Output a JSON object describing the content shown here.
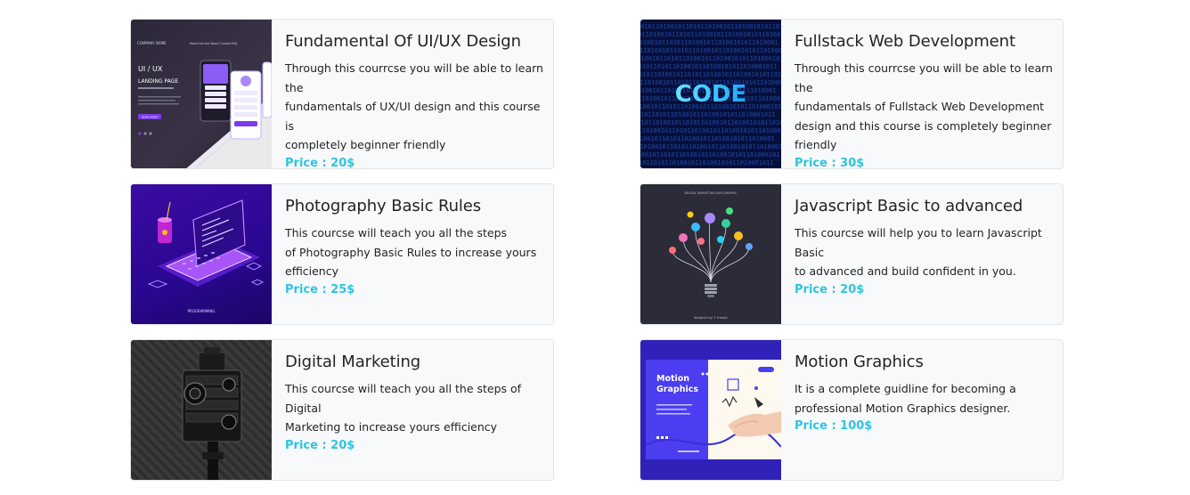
{
  "courses": [
    {
      "title": "Fundamental Of UI/UX Design",
      "desc": [
        "Through this courrcse you will be able to learn the",
        "fundamentals of UX/UI design and this course is",
        "completely beginner friendly"
      ],
      "price": "Price : 20$",
      "thumb": {
        "brand": "COMPANY NAME",
        "nav": "Home  Service  About  Contact  FAQ",
        "heading1": "UI / UX",
        "heading2": "LANDING PAGE",
        "button": "READ MORE",
        "icon": "phone-mockup-illustration"
      }
    },
    {
      "title": "Fullstack Web Development",
      "desc": [
        "Through this courrcse you will be able to learn the",
        "fundamentals of Fullstack Web Development",
        "design and this course is completely beginner",
        "friendly"
      ],
      "price": "Price : 30$",
      "thumb": {
        "word": "CODE",
        "binary": "0101101001011010110100101101001010110100",
        "icon": "binary-code-illustration"
      }
    },
    {
      "title": "Photography Basic Rules",
      "desc": [
        "This courcse will teach you all the steps",
        "of Photography Basic Rules to increase yours",
        "efficiency"
      ],
      "price": "Price : 25$",
      "thumb": {
        "caption": "PROGRAMMING",
        "icon": "isometric-laptop-illustration"
      }
    },
    {
      "title": "Javascript Basic to advanced",
      "desc": [
        "This courcse will help you to learn Javascript Basic",
        "to advanced and build confident in you."
      ],
      "price": "Price : 20$",
      "thumb": {
        "header": "DIGITAL MARKETING INFOGRAPHIC",
        "footer": "designed by ⚘ freepik",
        "icon": "lightbulb-infographic-illustration"
      }
    },
    {
      "title": "Digital Marketing",
      "desc": [
        "This courcse will teach you all the steps of Digital",
        "Marketing to increase yours efficiency"
      ],
      "price": "Price : 20$",
      "thumb": {
        "icon": "vintage-camera-photo"
      }
    },
    {
      "title": "Motion Graphics",
      "desc": [
        "It is a complete guidline for becoming a",
        "professional Motion Graphics designer."
      ],
      "price": "Price : 100$",
      "thumb": {
        "line1": "Motion",
        "line2": "Graphics",
        "icon": "motion-graphics-hand-illustration"
      }
    }
  ],
  "colors": {
    "price": "#2ec4e0",
    "card_bg": "#f8f9fa",
    "card_border": "#e3e5e8"
  }
}
